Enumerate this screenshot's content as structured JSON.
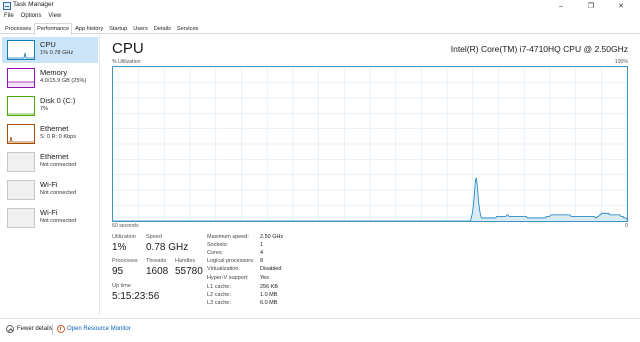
{
  "window": {
    "title": "Task Manager",
    "controls": {
      "minimize": "–",
      "maximize": "❐",
      "close": "✕"
    }
  },
  "menu": [
    "File",
    "Options",
    "View"
  ],
  "tabs": [
    "Processes",
    "Performance",
    "App history",
    "Startup",
    "Users",
    "Details",
    "Services"
  ],
  "active_tab": "Performance",
  "sidebar": [
    {
      "name": "CPU",
      "sub": "1% 0.78 GHz",
      "color": "#117dbb",
      "selected": true
    },
    {
      "name": "Memory",
      "sub": "4.0/15.9 GB (25%)",
      "color": "#8b12ae",
      "selected": false
    },
    {
      "name": "Disk 0 (C:)",
      "sub": "7%",
      "color": "#4da60c",
      "selected": false
    },
    {
      "name": "Ethernet",
      "sub": "S: 0 R: 0 Kbps",
      "color": "#a74f01",
      "selected": false
    },
    {
      "name": "Ethernet",
      "sub": "Not connected",
      "color": "#aaaaaa",
      "selected": false
    },
    {
      "name": "Wi-Fi",
      "sub": "Not connected",
      "color": "#aaaaaa",
      "selected": false
    },
    {
      "name": "Wi-Fi",
      "sub": "Not connected",
      "color": "#aaaaaa",
      "selected": false
    }
  ],
  "main": {
    "title": "CPU",
    "model": "Intel(R) Core(TM) i7-4710HQ CPU @ 2.50GHz",
    "graph_label": "% Utilization",
    "graph_max": "100%",
    "graph_span": "60 seconds",
    "graph_min": "0",
    "accent": "#117dbb"
  },
  "stats": {
    "utilization_label": "Utilization",
    "utilization": "1%",
    "speed_label": "Speed",
    "speed": "0.78 GHz",
    "processes_label": "Processes",
    "processes": "95",
    "threads_label": "Threads",
    "threads": "1608",
    "handles_label": "Handles",
    "handles": "55780",
    "uptime_label": "Up time",
    "uptime": "5:15:23:56"
  },
  "specs": [
    {
      "label": "Maximum speed:",
      "value": "2.50 GHz"
    },
    {
      "label": "Sockets:",
      "value": "1"
    },
    {
      "label": "Cores:",
      "value": "4"
    },
    {
      "label": "Logical processors:",
      "value": "8"
    },
    {
      "label": "Virtualization:",
      "value": "Disabled"
    },
    {
      "label": "Hyper-V support:",
      "value": "Yes"
    },
    {
      "label": "L1 cache:",
      "value": "256 KB"
    },
    {
      "label": "L2 cache:",
      "value": "1.0 MB"
    },
    {
      "label": "L3 cache:",
      "value": "6.0 MB"
    }
  ],
  "footer": {
    "fewer_details": "Fewer details",
    "open_monitor": "Open Resource Monitor"
  },
  "chart_data": {
    "type": "area",
    "x_range": [
      60,
      0
    ],
    "y_range": [
      0,
      100
    ],
    "values": [
      0,
      0,
      0,
      0,
      0,
      0,
      0,
      0,
      0,
      0,
      0,
      0,
      0,
      0,
      0,
      0,
      0,
      0,
      0,
      0,
      0,
      0,
      0,
      0,
      0,
      0,
      0,
      0,
      0,
      0,
      0,
      0,
      0,
      0,
      0,
      0,
      0,
      0,
      0,
      0,
      0,
      0,
      0,
      0,
      0,
      0,
      0,
      0,
      0,
      0,
      0,
      0,
      0,
      0,
      0,
      0,
      0,
      0,
      0,
      0,
      0,
      0,
      0,
      0,
      0,
      0,
      0,
      0,
      0,
      0,
      0,
      0,
      0,
      0,
      0,
      0,
      0,
      0,
      0,
      0,
      0,
      0,
      0,
      0,
      0,
      0,
      0,
      0,
      0,
      0,
      0,
      0,
      0,
      0,
      0,
      0,
      0,
      0,
      0,
      0,
      0,
      0,
      0,
      0,
      0,
      0,
      0,
      0,
      0,
      0,
      0,
      0,
      0,
      0,
      0,
      0,
      0,
      0,
      0,
      0,
      0,
      0,
      0,
      0,
      0,
      0,
      0,
      0,
      0,
      0,
      0,
      0,
      0,
      0,
      0,
      0,
      0,
      0,
      0,
      0,
      0,
      0,
      0,
      0,
      0,
      0,
      0,
      0,
      0,
      0,
      0,
      0,
      0,
      0,
      0,
      0,
      0,
      0,
      0,
      0,
      0,
      0,
      0,
      0,
      0,
      0,
      0,
      0,
      0,
      0,
      0,
      0,
      0,
      0,
      0,
      0,
      0,
      0,
      0,
      0,
      0,
      0,
      0,
      0,
      0,
      0,
      0,
      0,
      0,
      0,
      0,
      0,
      0,
      0,
      0,
      0,
      0,
      0,
      0,
      0,
      0,
      0,
      0,
      0,
      0,
      0,
      0,
      0,
      0,
      0,
      0,
      0,
      0,
      0,
      0,
      0,
      0,
      0,
      0,
      0,
      0,
      0,
      0,
      0,
      0,
      0,
      0,
      0,
      0,
      0,
      0,
      0,
      0,
      0,
      0,
      0,
      0,
      0,
      0,
      0,
      0,
      0,
      0,
      0,
      0,
      0,
      0,
      0,
      0,
      0,
      0,
      0,
      0,
      0,
      0,
      0,
      0,
      0,
      0,
      0,
      0,
      0,
      0,
      0,
      0,
      0,
      0,
      0,
      0,
      0,
      0,
      0,
      0,
      0,
      0,
      0,
      0,
      0,
      0,
      0,
      0,
      0,
      0,
      0,
      0,
      0,
      0,
      0,
      0,
      0,
      0,
      0,
      0,
      0,
      0,
      0,
      0,
      0,
      0,
      0,
      0,
      0,
      0,
      0,
      0,
      0,
      0,
      0,
      0,
      0,
      0,
      0,
      0,
      0,
      0,
      0,
      0,
      0,
      0,
      0,
      0,
      0,
      0,
      0,
      0,
      0,
      0,
      0,
      0,
      0,
      0,
      0,
      0,
      0,
      0,
      0,
      0,
      0,
      0,
      0,
      0,
      0,
      0,
      0,
      0,
      0,
      0,
      0,
      0,
      0,
      0,
      0,
      2,
      5,
      10,
      17,
      26,
      28,
      22,
      14,
      8,
      4,
      2,
      2,
      2,
      2,
      2,
      2,
      2,
      2,
      2,
      2,
      2,
      2,
      2,
      2,
      2,
      3,
      3,
      3,
      3,
      3,
      3,
      3,
      3,
      3,
      3,
      4,
      4,
      3,
      3,
      3,
      3,
      3,
      3,
      3,
      3,
      3,
      3,
      3,
      3,
      3,
      3,
      3,
      3,
      3,
      3,
      2,
      2,
      2,
      2,
      2,
      2,
      2,
      2,
      2,
      2,
      2,
      2,
      2,
      2,
      2,
      2,
      2,
      2,
      2,
      3,
      3,
      3,
      3,
      4,
      4,
      4,
      4,
      4,
      4,
      4,
      4,
      4,
      4,
      4,
      4,
      4,
      4,
      4,
      4,
      4,
      4,
      4,
      4,
      3,
      3,
      3,
      3,
      3,
      3,
      3,
      3,
      3,
      3,
      3,
      3,
      3,
      3,
      3,
      3,
      3,
      3,
      3,
      3,
      3,
      3,
      3,
      3,
      2,
      2,
      3,
      3,
      4,
      4,
      5,
      5,
      5,
      5,
      5,
      5,
      5,
      5,
      4,
      4,
      4,
      4,
      4,
      4,
      4,
      4,
      4,
      4,
      4,
      3,
      3,
      3,
      2,
      2,
      2,
      1
    ]
  }
}
